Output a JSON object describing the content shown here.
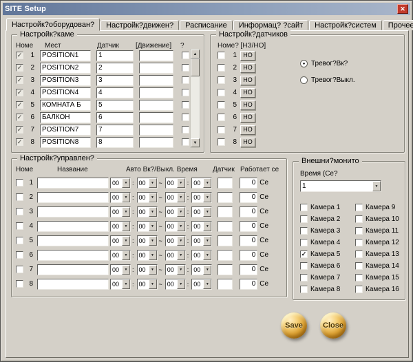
{
  "window": {
    "title": "SITE Setup",
    "close_glyph": "✕"
  },
  "icons": {
    "scroll_up": "▲",
    "scroll_down": "▼",
    "dropdown_arrow": "▼"
  },
  "tabs": [
    {
      "label": "Настройк?оборудован?"
    },
    {
      "label": "Настройк?движен?"
    },
    {
      "label": "Расписание"
    },
    {
      "label": "Информац? ?сайт"
    },
    {
      "label": "Настройк?систем"
    },
    {
      "label": "Прочее"
    }
  ],
  "camera_group": {
    "title": "Настройк?каме",
    "headers": {
      "num": "Номе",
      "place": "Мест",
      "sensor": "Датчик",
      "motion": "[Движение]",
      "extra": "?"
    },
    "rows": [
      {
        "num": "1",
        "checked": "✓",
        "place": "POSITION1",
        "sensor": "1",
        "motion": "",
        "extra": ""
      },
      {
        "num": "2",
        "checked": "✓",
        "place": "POSITION2",
        "sensor": "2",
        "motion": "",
        "extra": ""
      },
      {
        "num": "3",
        "checked": "✓",
        "place": "POSITION3",
        "sensor": "3",
        "motion": "",
        "extra": ""
      },
      {
        "num": "4",
        "checked": "✓",
        "place": "POSITION4",
        "sensor": "4",
        "motion": "",
        "extra": ""
      },
      {
        "num": "5",
        "checked": "✓",
        "place": "КОМНАТА Б",
        "sensor": "5",
        "motion": "",
        "extra": ""
      },
      {
        "num": "6",
        "checked": "✓",
        "place": "БАЛКОН",
        "sensor": "6",
        "motion": "",
        "extra": ""
      },
      {
        "num": "7",
        "checked": "✓",
        "place": "POSITION7",
        "sensor": "7",
        "motion": "",
        "extra": ""
      },
      {
        "num": "8",
        "checked": "✓",
        "place": "POSITION8",
        "sensor": "8",
        "motion": "",
        "extra": ""
      }
    ]
  },
  "sensor_group": {
    "title": "Настройк?датчиков",
    "header": "Номе? [НЗ/НО]",
    "rows": [
      {
        "num": "1",
        "checked": "",
        "btn": "НО"
      },
      {
        "num": "2",
        "checked": "",
        "btn": "НО"
      },
      {
        "num": "3",
        "checked": "",
        "btn": "НО"
      },
      {
        "num": "4",
        "checked": "",
        "btn": "НО"
      },
      {
        "num": "5",
        "checked": "",
        "btn": "НО"
      },
      {
        "num": "6",
        "checked": "",
        "btn": "НО"
      },
      {
        "num": "7",
        "checked": "",
        "btn": "НО"
      },
      {
        "num": "8",
        "checked": "",
        "btn": "НО"
      }
    ],
    "radios": [
      {
        "label": "Тревог?Вк?",
        "dot": "●"
      },
      {
        "label": "Тревог?Выкл.",
        "dot": ""
      }
    ]
  },
  "control_group": {
    "title": "Настройк?управлен?",
    "headers": {
      "num": "Номе",
      "name": "Название",
      "time": "Авто Вк?/Выкл. Время",
      "sensor": "Датчик",
      "works": "Работает се"
    },
    "time_value": "00",
    "colon": ":",
    "tilde": "~",
    "rows": [
      {
        "num": "1",
        "checked": "",
        "name": "",
        "sensor": "",
        "seconds": "0",
        "unit": "Се"
      },
      {
        "num": "2",
        "checked": "",
        "name": "",
        "sensor": "",
        "seconds": "0",
        "unit": "Се"
      },
      {
        "num": "3",
        "checked": "",
        "name": "",
        "sensor": "",
        "seconds": "0",
        "unit": "Се"
      },
      {
        "num": "4",
        "checked": "",
        "name": "",
        "sensor": "",
        "seconds": "0",
        "unit": "Се"
      },
      {
        "num": "5",
        "checked": "",
        "name": "",
        "sensor": "",
        "seconds": "0",
        "unit": "Се"
      },
      {
        "num": "6",
        "checked": "",
        "name": "",
        "sensor": "",
        "seconds": "0",
        "unit": "Се"
      },
      {
        "num": "7",
        "checked": "",
        "name": "",
        "sensor": "",
        "seconds": "0",
        "unit": "Се"
      },
      {
        "num": "8",
        "checked": "",
        "name": "",
        "sensor": "",
        "seconds": "0",
        "unit": "Се"
      }
    ]
  },
  "monitor_group": {
    "title": "Внешни?монито",
    "time_label": "Время (Се?",
    "time_value": "1",
    "cameras": [
      {
        "label": "Камера 1",
        "checked": ""
      },
      {
        "label": "Камера 2",
        "checked": ""
      },
      {
        "label": "Камера 3",
        "checked": ""
      },
      {
        "label": "Камера 4",
        "checked": ""
      },
      {
        "label": "Камера 5",
        "checked": "✓"
      },
      {
        "label": "Камера 6",
        "checked": ""
      },
      {
        "label": "Камера 7",
        "checked": ""
      },
      {
        "label": "Камера 8",
        "checked": ""
      },
      {
        "label": "Камера 9",
        "checked": ""
      },
      {
        "label": "Камера 10",
        "checked": ""
      },
      {
        "label": "Камера 11",
        "checked": ""
      },
      {
        "label": "Камера 12",
        "checked": ""
      },
      {
        "label": "Камера 13",
        "checked": ""
      },
      {
        "label": "Камера 14",
        "checked": ""
      },
      {
        "label": "Камера 15",
        "checked": ""
      },
      {
        "label": "Камера 16",
        "checked": ""
      }
    ]
  },
  "actions": {
    "save": "Save",
    "close": "Close"
  }
}
